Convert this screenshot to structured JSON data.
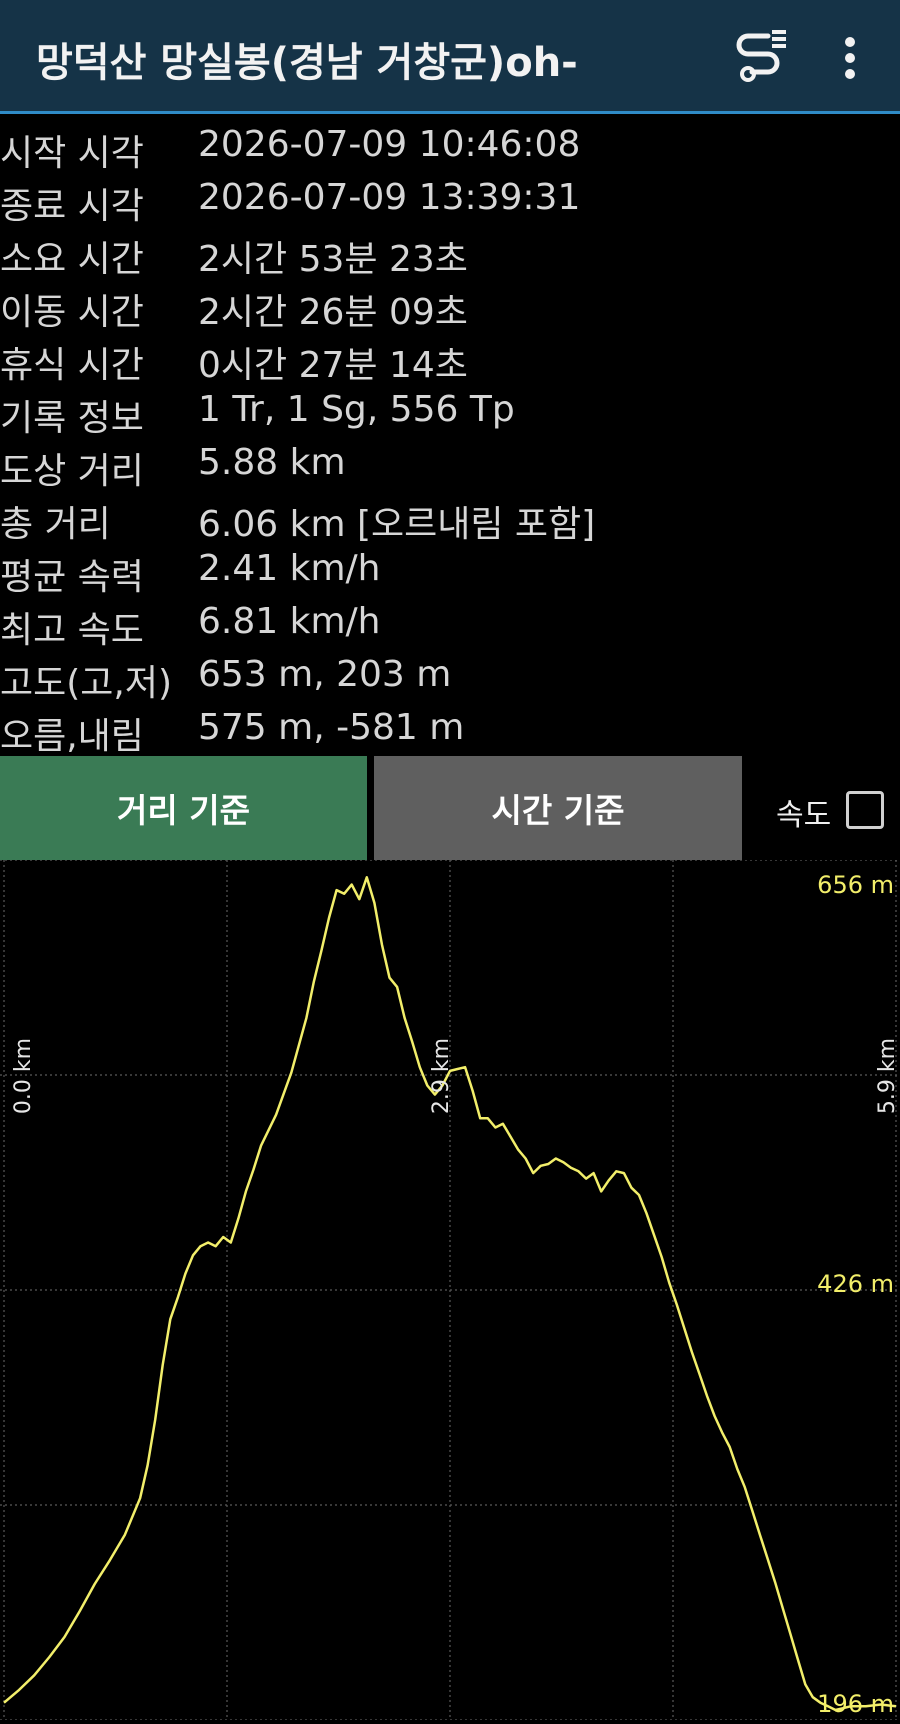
{
  "app": {
    "title": "망덕산 망실봉(경남 거창군)oh-",
    "icons": {
      "route": "route-icon",
      "menu": "more-vert-icon"
    }
  },
  "info": [
    {
      "label": "시작 시각",
      "value": "2026-07-09 10:46:08"
    },
    {
      "label": "종료 시각",
      "value": "2026-07-09 13:39:31"
    },
    {
      "label": "소요 시간",
      "value": "2시간 53분 23초"
    },
    {
      "label": "이동 시간",
      "value": "2시간 26분 09초"
    },
    {
      "label": "휴식 시간",
      "value": "0시간 27분 14초"
    },
    {
      "label": "기록 정보",
      "value": "1 Tr, 1 Sg, 556 Tp"
    },
    {
      "label": "도상 거리",
      "value": "5.88 km"
    },
    {
      "label": "총 거리",
      "value": "6.06 km [오르내림 포함]"
    },
    {
      "label": "평균 속력",
      "value": "2.41 km/h"
    },
    {
      "label": "최고 속도",
      "value": "6.81 km/h"
    },
    {
      "label": "고도(고,저)",
      "value": "653 m, 203 m"
    },
    {
      "label": "오름,내림",
      "value": "575 m, -581 m"
    }
  ],
  "tabs": {
    "distance": "거리 기준",
    "time": "시간 기준"
  },
  "speed_toggle": {
    "label": "속도",
    "checked": false
  },
  "colors": {
    "appbar": "#153347",
    "accent": "#2f8bc7",
    "tab_active": "#3a7b55",
    "tab_inactive": "#5f5f5f",
    "line": "#f2ee6a",
    "grid": "#5a5a5a"
  },
  "chart_data": {
    "type": "line",
    "x_unit": "km",
    "y_unit": "m",
    "x_ticks": [
      "0.0 km",
      "2.9 km",
      "5.9 km"
    ],
    "y_ticks": [
      "656 m",
      "426 m",
      "196 m"
    ],
    "xlim": [
      0,
      5.9
    ],
    "ylim": [
      196,
      656
    ],
    "grid": true,
    "series": [
      {
        "x": [
          0.0,
          0.1,
          0.2,
          0.3,
          0.4,
          0.5,
          0.6,
          0.7,
          0.8,
          0.9,
          0.95,
          1.0,
          1.05,
          1.1,
          1.15,
          1.2,
          1.25,
          1.3,
          1.35,
          1.4,
          1.45,
          1.5,
          1.55,
          1.6,
          1.65,
          1.7,
          1.8,
          1.9,
          2.0,
          2.05,
          2.1,
          2.15,
          2.2,
          2.25,
          2.3,
          2.35,
          2.4,
          2.45,
          2.5,
          2.55,
          2.6,
          2.65,
          2.7,
          2.75,
          2.8,
          2.85,
          2.9,
          2.95,
          3.0,
          3.05,
          3.1,
          3.15,
          3.2,
          3.25,
          3.3,
          3.35,
          3.4,
          3.45,
          3.5,
          3.55,
          3.6,
          3.65,
          3.7,
          3.75,
          3.8,
          3.85,
          3.9,
          3.95,
          4.0,
          4.05,
          4.1,
          4.15,
          4.2,
          4.25,
          4.3,
          4.35,
          4.4,
          4.45,
          4.5,
          4.55,
          4.6,
          4.65,
          4.7,
          4.75,
          4.8,
          4.85,
          4.9,
          4.95,
          5.0,
          5.05,
          5.1,
          5.15,
          5.2,
          5.25,
          5.3,
          5.35,
          5.4,
          5.45,
          5.5,
          5.55,
          5.6,
          5.7,
          5.8,
          5.9
        ],
        "y": [
          200,
          207,
          215,
          225,
          236,
          250,
          265,
          278,
          292,
          312,
          330,
          355,
          385,
          410,
          422,
          435,
          445,
          450,
          452,
          450,
          455,
          452,
          465,
          480,
          492,
          505,
          522,
          545,
          575,
          595,
          612,
          630,
          645,
          643,
          648,
          640,
          652,
          638,
          615,
          597,
          592,
          575,
          562,
          548,
          538,
          533,
          538,
          546,
          547,
          548,
          535,
          520,
          520,
          515,
          517,
          510,
          503,
          498,
          490,
          494,
          495,
          498,
          496,
          493,
          491,
          487,
          490,
          480,
          486,
          491,
          490,
          482,
          478,
          468,
          456,
          444,
          430,
          418,
          405,
          392,
          380,
          368,
          357,
          348,
          340,
          328,
          318,
          305,
          292,
          279,
          266,
          252,
          238,
          224,
          210,
          203,
          200,
          198,
          196,
          197,
          198,
          198,
          199,
          198
        ]
      }
    ]
  }
}
